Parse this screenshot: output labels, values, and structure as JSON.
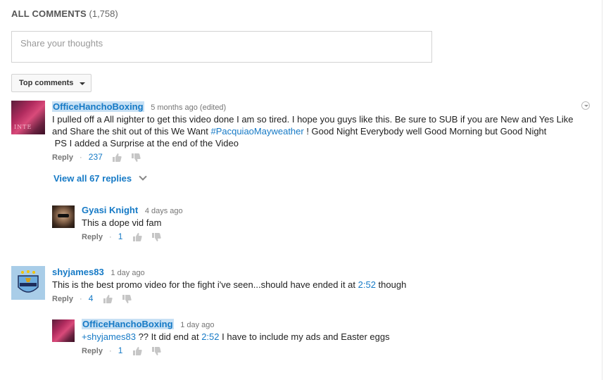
{
  "header": {
    "title": "ALL COMMENTS",
    "count": "(1,758)"
  },
  "share": {
    "placeholder": "Share your thoughts"
  },
  "sort": {
    "label": "Top comments"
  },
  "comments": [
    {
      "author": "OfficeHanchoBoxing",
      "time": "5 months ago (edited)",
      "line1": "I pulled off a All nighter to get this video done I am so tired. I hope you guys like this. Be sure to SUB if you are New and Yes Like",
      "line2_a": "and Share the shit out of this We Want ",
      "line2_tag": "#PacquiaoMayweather",
      "line2_b": " ! Good Night Everybody well Good Morning but Good Night",
      "line3": " PS I added a Surprise at the end of the Video",
      "reply_label": "Reply",
      "likes": "237",
      "avatar_text": "INTE"
    },
    {
      "author": "shyjames83",
      "time": "1 day ago",
      "text_a": "This is the best promo video for the fight i've seen...should have ended it at ",
      "text_link": "2:52",
      "text_b": " though",
      "reply_label": "Reply",
      "likes": "4"
    }
  ],
  "view_replies": {
    "label": "View all 67 replies"
  },
  "replies": [
    {
      "author": "Gyasi Knight",
      "time": "4 days ago",
      "text": "This a dope vid fam",
      "reply_label": "Reply",
      "likes": "1"
    },
    {
      "author": "OfficeHanchoBoxing",
      "time": "1 day ago",
      "mention": "+shyjames83",
      "text_a": " ?? It did end at ",
      "text_link": "2:52",
      "text_b": " I have to include my ads and Easter eggs",
      "reply_label": "Reply",
      "likes": "1"
    }
  ],
  "icons": {
    "like": "thumbs-up-icon",
    "dislike": "thumbs-down-icon",
    "menu": "chevron-down-icon"
  },
  "colors": {
    "link": "#167ac6",
    "highlight": "#c7e0f4",
    "muted": "#767676"
  }
}
